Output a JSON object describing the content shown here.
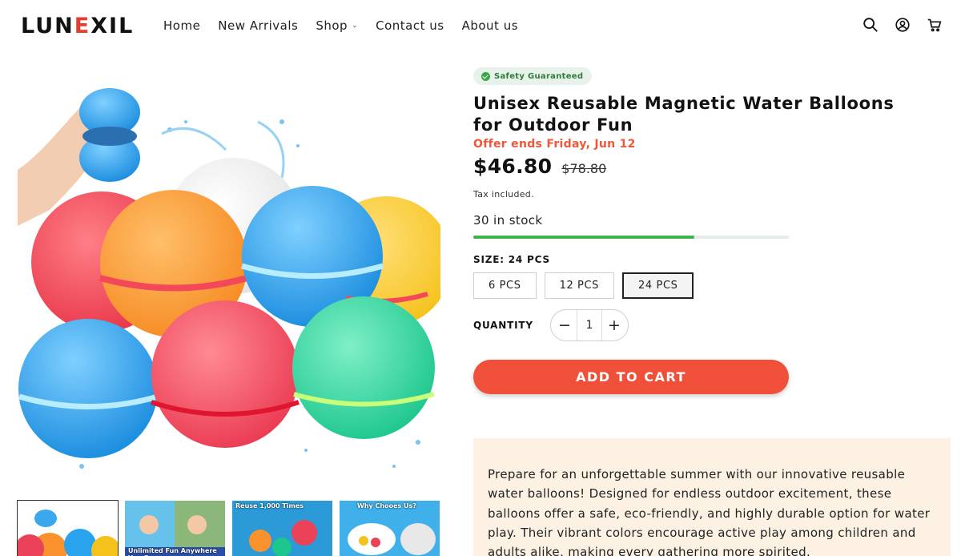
{
  "brand": {
    "logo_pre": "LUN",
    "logo_x": "E",
    "logo_post": "XIL"
  },
  "nav": {
    "items": [
      {
        "label": "Home"
      },
      {
        "label": "New Arrivals"
      },
      {
        "label": "Shop"
      },
      {
        "label": "Contact us"
      },
      {
        "label": "About us"
      }
    ]
  },
  "header_icons": [
    "search-icon",
    "account-icon",
    "cart-icon"
  ],
  "product": {
    "badge": "Safety Guaranteed",
    "title": "Unisex Reusable Magnetic Water Balloons for Outdoor Fun",
    "offer": "Offer ends Friday, Jun 12",
    "price": "$46.80",
    "compare_price": "$78.80",
    "tax_note": "Tax included.",
    "stock_text": "30 in stock",
    "stock_level": 0.7,
    "size_label": "SIZE: 24 PCS",
    "sizes": [
      "6 PCS",
      "12 PCS",
      "24 PCS"
    ],
    "selected_size": "24 PCS",
    "quantity_label": "QUANTITY",
    "quantity": "1",
    "qty_minus": "−",
    "qty_plus": "+",
    "add_to_cart": "ADD TO CART",
    "description": "Prepare for an unforgettable summer with our innovative reusable water balloons! Designed for endless outdoor excitement, these balloons offer a safe, eco-friendly, and highly durable option for water play. Their vibrant colors encourage active play among children and adults alike, making every gathering more spirited."
  },
  "thumbnails": [
    {
      "caption": ""
    },
    {
      "caption": "Unlimited Fun Anywhere You Go"
    },
    {
      "caption": "Reuse 1,000 Times"
    },
    {
      "caption": "Why Chooes Us?"
    }
  ],
  "colors": {
    "accent": "#f0503a",
    "offer": "#f0563a",
    "badge_bg": "#e7f3ea",
    "stock": "#43b14f",
    "desc_bg": "#fcf1e3"
  }
}
